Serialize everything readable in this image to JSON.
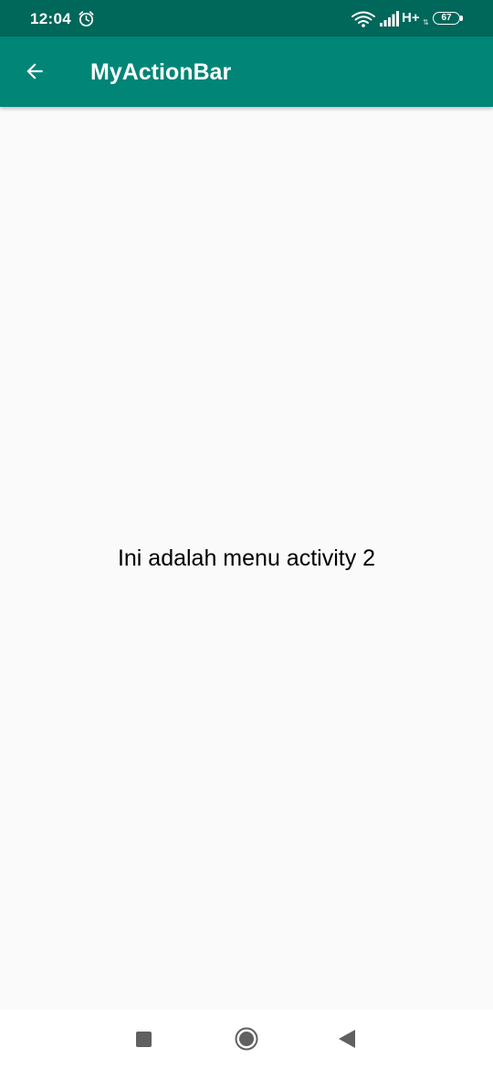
{
  "status_bar": {
    "time": "12:04",
    "network_type": "H+",
    "network_arrows": "⇅",
    "battery_level": "67",
    "icons": [
      "alarm-icon",
      "wifi-icon",
      "signal-icon",
      "battery-icon"
    ]
  },
  "app_bar": {
    "title": "MyActionBar",
    "back_icon": "arrow-back-icon"
  },
  "content": {
    "message": "Ini adalah menu activity 2"
  },
  "nav_bar": {
    "icons": [
      "recents-square-icon",
      "home-circle-icon",
      "back-triangle-icon"
    ]
  },
  "colors": {
    "status_bar": "#00675b",
    "app_bar": "#008577",
    "background": "#fafafa",
    "text": "#000000",
    "nav_icon": "#606060"
  }
}
